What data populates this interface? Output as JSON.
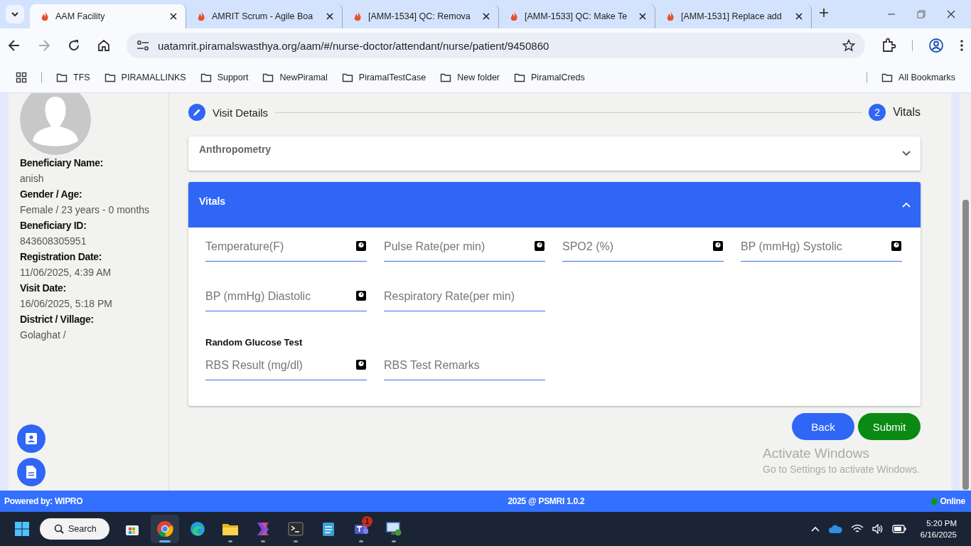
{
  "browser": {
    "tabs": [
      {
        "title": "AAM Facility",
        "selected": true
      },
      {
        "title": "AMRIT Scrum - Agile Boa",
        "selected": false
      },
      {
        "title": "[AMM-1534] QC: Remova",
        "selected": false
      },
      {
        "title": "[AMM-1533] QC: Make Te",
        "selected": false
      },
      {
        "title": "[AMM-1531] Replace add",
        "selected": false
      }
    ],
    "url": "uatamrit.piramalswasthya.org/aam/#/nurse-doctor/attendant/nurse/patient/9450860",
    "bookmarks": [
      "TFS",
      "PIRAMALLINKS",
      "Support",
      "NewPiramal",
      "PiramalTestCase",
      "New folder",
      "PiramalCreds"
    ],
    "all_bookmarks": "All Bookmarks"
  },
  "beneficiary": {
    "fields": [
      {
        "label": "Beneficiary Name:",
        "value": "anish"
      },
      {
        "label": "Gender / Age:",
        "value": "Female / 23 years - 0 months"
      },
      {
        "label": "Beneficiary ID:",
        "value": "843608305951"
      },
      {
        "label": "Registration Date:",
        "value": "11/06/2025, 4:39 AM"
      },
      {
        "label": "Visit Date:",
        "value": "16/06/2025, 5:18 PM"
      },
      {
        "label": "District / Village:",
        "value": "Golaghat /"
      }
    ]
  },
  "stepper": [
    {
      "kind": "edit",
      "label": "Visit Details"
    },
    {
      "kind": "number",
      "number": "2",
      "label": "Vitals"
    }
  ],
  "panels": [
    {
      "title": "Anthropometry",
      "expanded": false
    },
    {
      "title": "Vitals",
      "expanded": true
    }
  ],
  "vitals": {
    "rows": [
      [
        {
          "placeholder": "Temperature(F)",
          "device_icon": true
        },
        {
          "placeholder": "Pulse Rate(per min)",
          "device_icon": true
        },
        {
          "placeholder": "SPO2 (%)",
          "device_icon": true
        },
        {
          "placeholder": "BP (mmHg) Systolic",
          "device_icon": true
        }
      ],
      [
        {
          "placeholder": "BP (mmHg) Diastolic",
          "device_icon": true
        },
        {
          "placeholder": "Respiratory Rate(per min)",
          "device_icon": false
        }
      ]
    ],
    "glucose_title": "Random Glucose Test",
    "glucose_fields": [
      {
        "placeholder": "RBS Result (mg/dl)",
        "device_icon": true
      },
      {
        "placeholder": "RBS Test Remarks",
        "device_icon": false
      }
    ]
  },
  "buttons": [
    {
      "label": "Back",
      "kind": "primary"
    },
    {
      "label": "Submit",
      "kind": "success"
    }
  ],
  "activation_notice": {
    "title": "Activate Windows",
    "subtitle": "Go to Settings to activate Windows."
  },
  "footer": {
    "left": "Powered by: WIPRO",
    "center": "2025 @ PSMRI 1.0.2",
    "status": "Online"
  },
  "taskbar": {
    "search": "Search",
    "apps": [
      {
        "kind": "store",
        "selected": false,
        "running": false
      },
      {
        "kind": "chrome",
        "selected": true,
        "running": true
      },
      {
        "kind": "edge",
        "selected": false,
        "running": false
      },
      {
        "kind": "files",
        "selected": false,
        "running": true
      },
      {
        "kind": "office",
        "selected": false,
        "running": true
      },
      {
        "kind": "terminal",
        "selected": false,
        "running": true
      },
      {
        "kind": "notepad",
        "selected": false,
        "running": false
      },
      {
        "kind": "teams",
        "selected": false,
        "running": true,
        "badge": "1"
      },
      {
        "kind": "remote",
        "selected": false,
        "running": true
      }
    ],
    "time": "5:20 PM",
    "date": "6/16/2025"
  }
}
